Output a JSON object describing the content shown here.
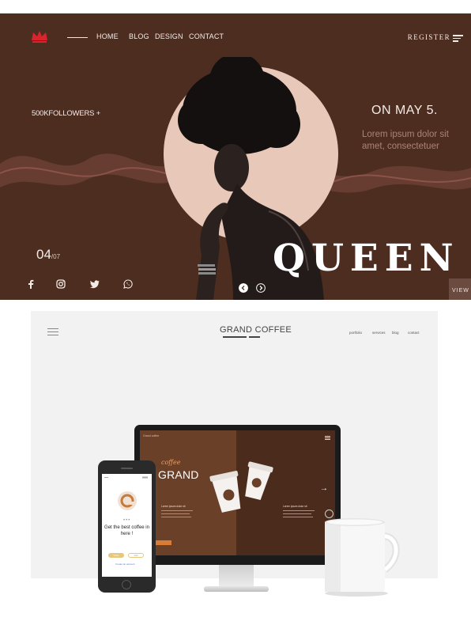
{
  "hero": {
    "nav": [
      "HOME",
      "BLOG",
      "DESIGN",
      "CONTACT"
    ],
    "register_label": "REGISTER",
    "followers": "500KFOLLOWERS +",
    "date": "ON MAY 5.",
    "lorem": "Lorem ipsum dolor sit amet, consectetuer",
    "counter_current": "04",
    "counter_total": "/07",
    "headline": "QUEEN",
    "view_label": "VIEW",
    "social_icons": [
      "facebook-icon",
      "instagram-icon",
      "twitter-icon",
      "whatsapp-icon"
    ],
    "colors": {
      "background": "#4e2d21",
      "circle": "#e7c8b9",
      "accent": "#d9232d"
    }
  },
  "mockup": {
    "brand": "GRAND COFFEE",
    "nav": [
      "portfolio",
      "services",
      "blog",
      "contact"
    ],
    "desktop": {
      "top_label": "Grand coffee",
      "script_word": "coffee",
      "big_word": "GRAND",
      "caption_left": "Lorem ipsum dolor sit",
      "caption_right": "Lorem ipsum dolor sit"
    },
    "phone": {
      "title": "Get the best coffee in here !",
      "button_primary": "Order",
      "button_secondary": "Visit",
      "link": "Create an account"
    },
    "colors": {
      "screen_left": "#6b4028",
      "screen_right": "#4b2b1c",
      "orange": "#d77b36"
    }
  }
}
